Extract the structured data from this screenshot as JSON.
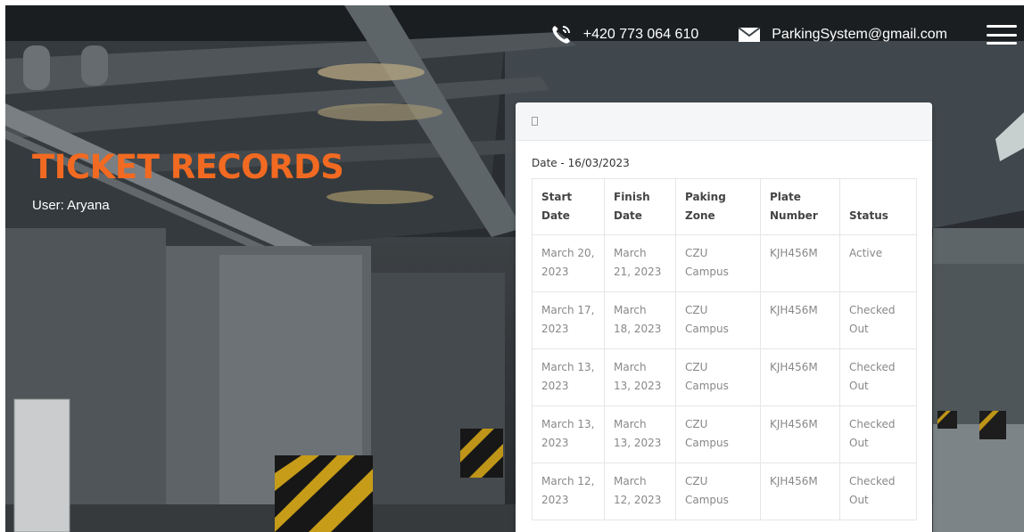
{
  "header": {
    "phone": "+420 773 064 610",
    "email": "ParkingSystem@gmail.com",
    "icons": {
      "phone": "phone-icon",
      "email": "envelope-icon",
      "menu": "hamburger-menu-icon"
    }
  },
  "page": {
    "title": "TICKET RECORDS",
    "user_label": "User: Aryana"
  },
  "card": {
    "header_glyph": "",
    "date_label": "Date - 16/03/2023",
    "table": {
      "columns": [
        "Start Date",
        "Finish Date",
        "Paking Zone",
        "Plate Number",
        "Status"
      ],
      "rows": [
        [
          "March 20, 2023",
          "March 21, 2023",
          "CZU Campus",
          "KJH456M",
          "Active"
        ],
        [
          "March 17, 2023",
          "March 18, 2023",
          "CZU Campus",
          "KJH456M",
          "Checked Out"
        ],
        [
          "March 13, 2023",
          "March 13, 2023",
          "CZU Campus",
          "KJH456M",
          "Checked Out"
        ],
        [
          "March 13, 2023",
          "March 13, 2023",
          "CZU Campus",
          "KJH456M",
          "Checked Out"
        ],
        [
          "March 12, 2023",
          "March 12, 2023",
          "CZU Campus",
          "KJH456M",
          "Checked Out"
        ]
      ]
    }
  },
  "colors": {
    "title_accent": "#f26a21",
    "text_light": "#ffffff",
    "table_text": "#888888",
    "table_header_text": "#444444"
  }
}
